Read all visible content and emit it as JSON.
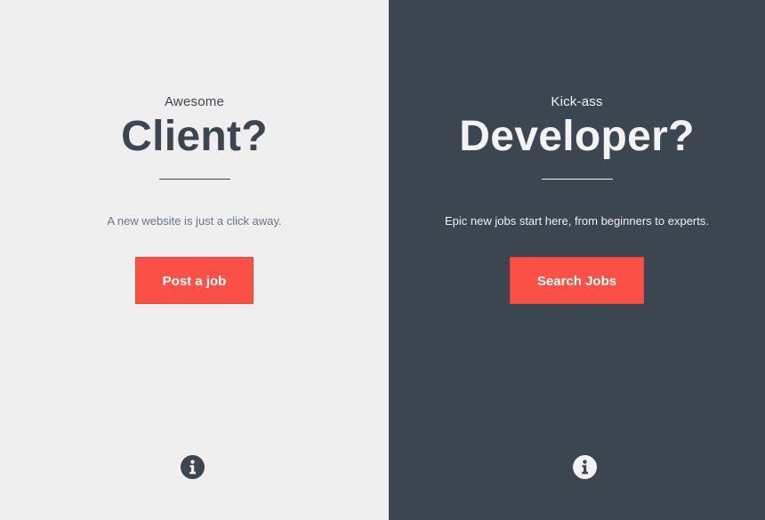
{
  "client": {
    "eyebrow": "Awesome",
    "headline": "Client?",
    "tagline": "A new website is just a click away.",
    "cta_label": "Post a job",
    "info_icon": "info-circle-icon"
  },
  "developer": {
    "eyebrow": "Kick-ass",
    "headline": "Developer?",
    "tagline": "Epic new jobs start here, from beginners to experts.",
    "cta_label": "Search Jobs",
    "info_icon": "info-circle-icon"
  },
  "colors": {
    "client_bg": "#efefef",
    "developer_bg": "#3b4650",
    "accent": "#fb5045",
    "dark_text": "#3b4650",
    "light_text": "#f3f3f3"
  }
}
